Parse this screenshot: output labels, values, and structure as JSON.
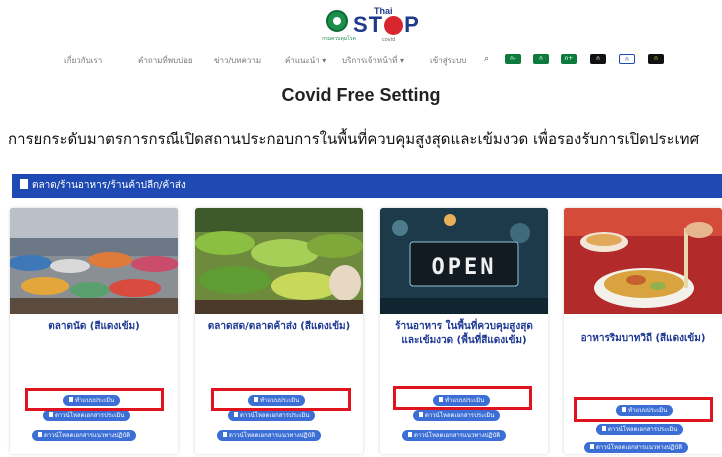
{
  "header": {
    "logo_caption": "กรมควบคุมโรค",
    "logo_brand_small": "Thai",
    "logo_brand_big": "STOP",
    "logo_brand_sub": "covid"
  },
  "nav": {
    "items": [
      "เกี่ยวกับเรา",
      "คำถามที่พบบ่อย",
      "ข่าว/บทความ",
      "คำแนะนำ ▾",
      "บริการเจ้าหน้าที่ ▾",
      "เข้าสู่ระบบ"
    ],
    "search_icon": "search-icon",
    "font_pills": [
      {
        "label": "ก-",
        "bg": "#0b7a3b",
        "fg": "#ffffff"
      },
      {
        "label": "ก",
        "bg": "#0b7a3b",
        "fg": "#ffffff"
      },
      {
        "label": "ก+",
        "bg": "#0b7a3b",
        "fg": "#ffffff"
      },
      {
        "label": "ก",
        "bg": "#111111",
        "fg": "#ffffff"
      },
      {
        "label": "ก",
        "bg": "#ffffff",
        "fg": "#1f49b3"
      },
      {
        "label": "ก",
        "bg": "#111111",
        "fg": "#f5d90a"
      }
    ]
  },
  "page": {
    "title": "Covid Free Setting",
    "subheading": "การยกระดับมาตรการกรณีเปิดสถานประกอบการในพื้นที่ควบคุมสูงสุดและเข้มงวด เพื่อรองรับการเปิดประเทศ"
  },
  "category": {
    "label": "ตลาด/ร้านอาหาร/ร้านค้าปลีก/ค้าส่ง"
  },
  "cards": [
    {
      "title": "ตลาดนัด (สีแดงเข้ม)",
      "buttons": [
        "ทำแบบประเมิน",
        "ดาวน์โหลดเอกสารประเมิน",
        "ดาวน์โหลดเอกสารแนวทางปฏิบัติ"
      ]
    },
    {
      "title": "ตลาดสด/ตลาดค้าส่ง (สีแดงเข้ม)",
      "buttons": [
        "ทำแบบประเมิน",
        "ดาวน์โหลดเอกสารประเมิน",
        "ดาวน์โหลดเอกสารแนวทางปฏิบัติ"
      ]
    },
    {
      "title": "ร้านอาหาร ในพื้นที่ควบคุมสูงสุดและเข้มงวด (พื้นที่สีแดงเข้ม)",
      "image_text": "OPEN",
      "buttons": [
        "ทำแบบประเมิน",
        "ดาวน์โหลดเอกสารประเมิน",
        "ดาวน์โหลดเอกสารแนวทางปฏิบัติ"
      ]
    },
    {
      "title": "อาหารริมบาทวิถี (สีแดงเข้ม)",
      "buttons": [
        "ทำแบบประเมิน",
        "ดาวน์โหลดเอกสารประเมิน",
        "ดาวน์โหลดเอกสารแนวทางปฏิบัติ"
      ]
    }
  ],
  "colors": {
    "brand_blue": "#1f49b3",
    "button_blue": "#3b6fd6",
    "highlight_red": "#e0141e"
  }
}
